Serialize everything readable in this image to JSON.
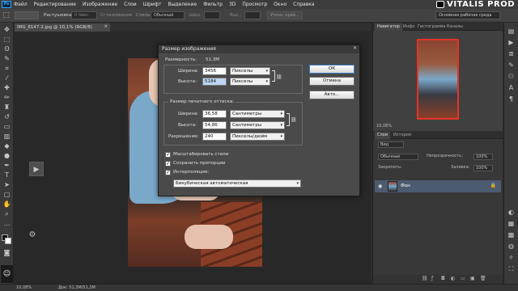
{
  "menu": {
    "app_icon": "Ps",
    "items": [
      "Файл",
      "Редактирование",
      "Изображение",
      "Слои",
      "Шрифт",
      "Выделение",
      "Фильтр",
      "3D",
      "Просмотр",
      "Окно",
      "Справка"
    ]
  },
  "brand": {
    "text": "VITALIS PROD"
  },
  "options": {
    "feather_label": "Растушевка:",
    "feather_value": "0 пикс.",
    "smooth_label": "Сглаживание",
    "style_label": "Стиль:",
    "style_value": "Обычный",
    "width_label": "Шир.:",
    "height_label": "Выс.:",
    "refine_button": "Уточн. край...",
    "workspace": "Основная рабочая среда"
  },
  "document": {
    "tab_title": "IMG_8147-2.jpg @ 10,1% (RGB/8)"
  },
  "status": {
    "zoom": "10,08%",
    "doc_info": "Док: 51,3M/51,3M"
  },
  "panels": {
    "nav_tabs": [
      "Навигатор",
      "Инфо",
      "Гистограмма",
      "Каналы"
    ],
    "nav_zoom": "10,08%",
    "layer_tabs": [
      "Слои",
      "История"
    ],
    "layers": {
      "kind_label": "Вид",
      "blend_mode": "Обычные",
      "opacity_label": "Непрозрачность:",
      "opacity_value": "100%",
      "lock_label": "Закрепить:",
      "fill_label": "Заливка:",
      "fill_value": "100%",
      "items": [
        {
          "name": "Фон"
        }
      ]
    }
  },
  "dialog": {
    "title": "Размер изображения",
    "pixel_dims_label": "Размерность:",
    "pixel_dims_value": "51,3M",
    "width_label": "Ширина:",
    "width_value": "3456",
    "width_unit": "Пикселы",
    "height_label": "Высота:",
    "height_value": "5184",
    "height_unit": "Пикселы",
    "print_group": "Размер печатного оттиска:",
    "print_width_label": "Ширина:",
    "print_width_value": "36,58",
    "print_width_unit": "Сантиметры",
    "print_height_label": "Высота:",
    "print_height_value": "54,86",
    "print_height_unit": "Сантиметры",
    "resolution_label": "Разрешение:",
    "resolution_value": "240",
    "resolution_unit": "Пикселы/дюйм",
    "scale_styles": "Масштабировать стили",
    "constrain": "Сохранить пропорции",
    "resample": "Интерполяция:",
    "resample_method": "Бикубическая автоматическая",
    "ok": "ОК",
    "cancel": "Отмена",
    "auto": "Авто..."
  }
}
